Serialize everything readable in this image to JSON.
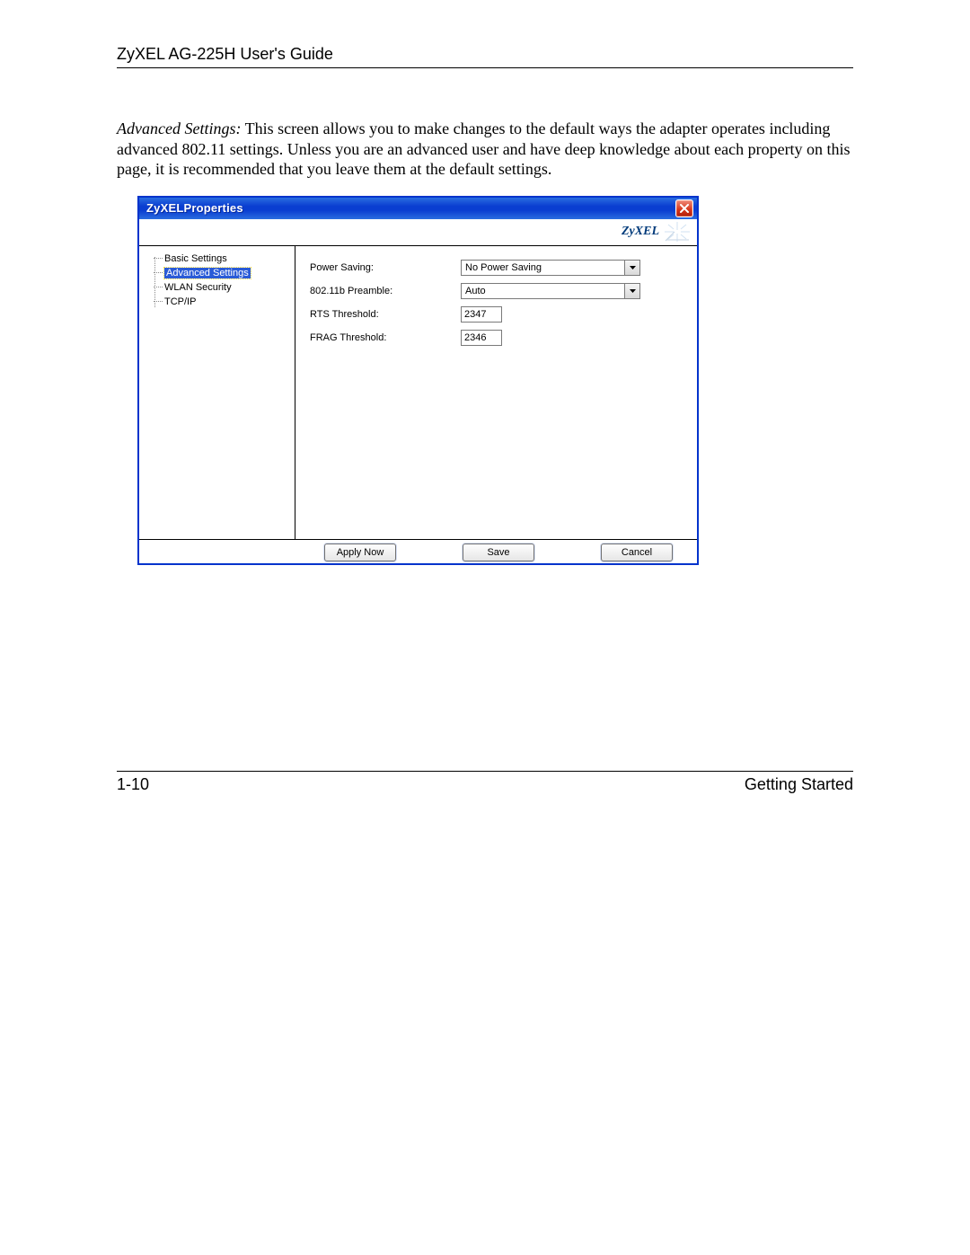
{
  "doc": {
    "header": "ZyXEL AG-225H User's Guide",
    "intro_lead": "Advanced Settings:",
    "intro_rest": " This screen allows you to make changes to the default ways the adapter operates including advanced 802.11 settings.  Unless you are an advanced user and have deep knowledge about each property on  this page, it is recommended that you leave them at the default settings.",
    "page_number": "1-10",
    "section_label": "Getting Started"
  },
  "dialog": {
    "title": "ZyXELProperties",
    "brand": "ZyXEL",
    "sidebar": {
      "items": [
        {
          "label": "Basic Settings",
          "selected": false
        },
        {
          "label": "Advanced Settings",
          "selected": true
        },
        {
          "label": "WLAN Security",
          "selected": false
        },
        {
          "label": "TCP/IP",
          "selected": false
        }
      ]
    },
    "form": {
      "power_saving": {
        "label": "Power Saving:",
        "value": "No Power Saving"
      },
      "preamble": {
        "label": "802.11b Preamble:",
        "value": "Auto"
      },
      "rts_threshold": {
        "label": "RTS Threshold:",
        "value": "2347"
      },
      "frag_threshold": {
        "label": "FRAG Threshold:",
        "value": "2346"
      }
    },
    "buttons": {
      "apply": "Apply Now",
      "save": "Save",
      "cancel": "Cancel"
    }
  }
}
